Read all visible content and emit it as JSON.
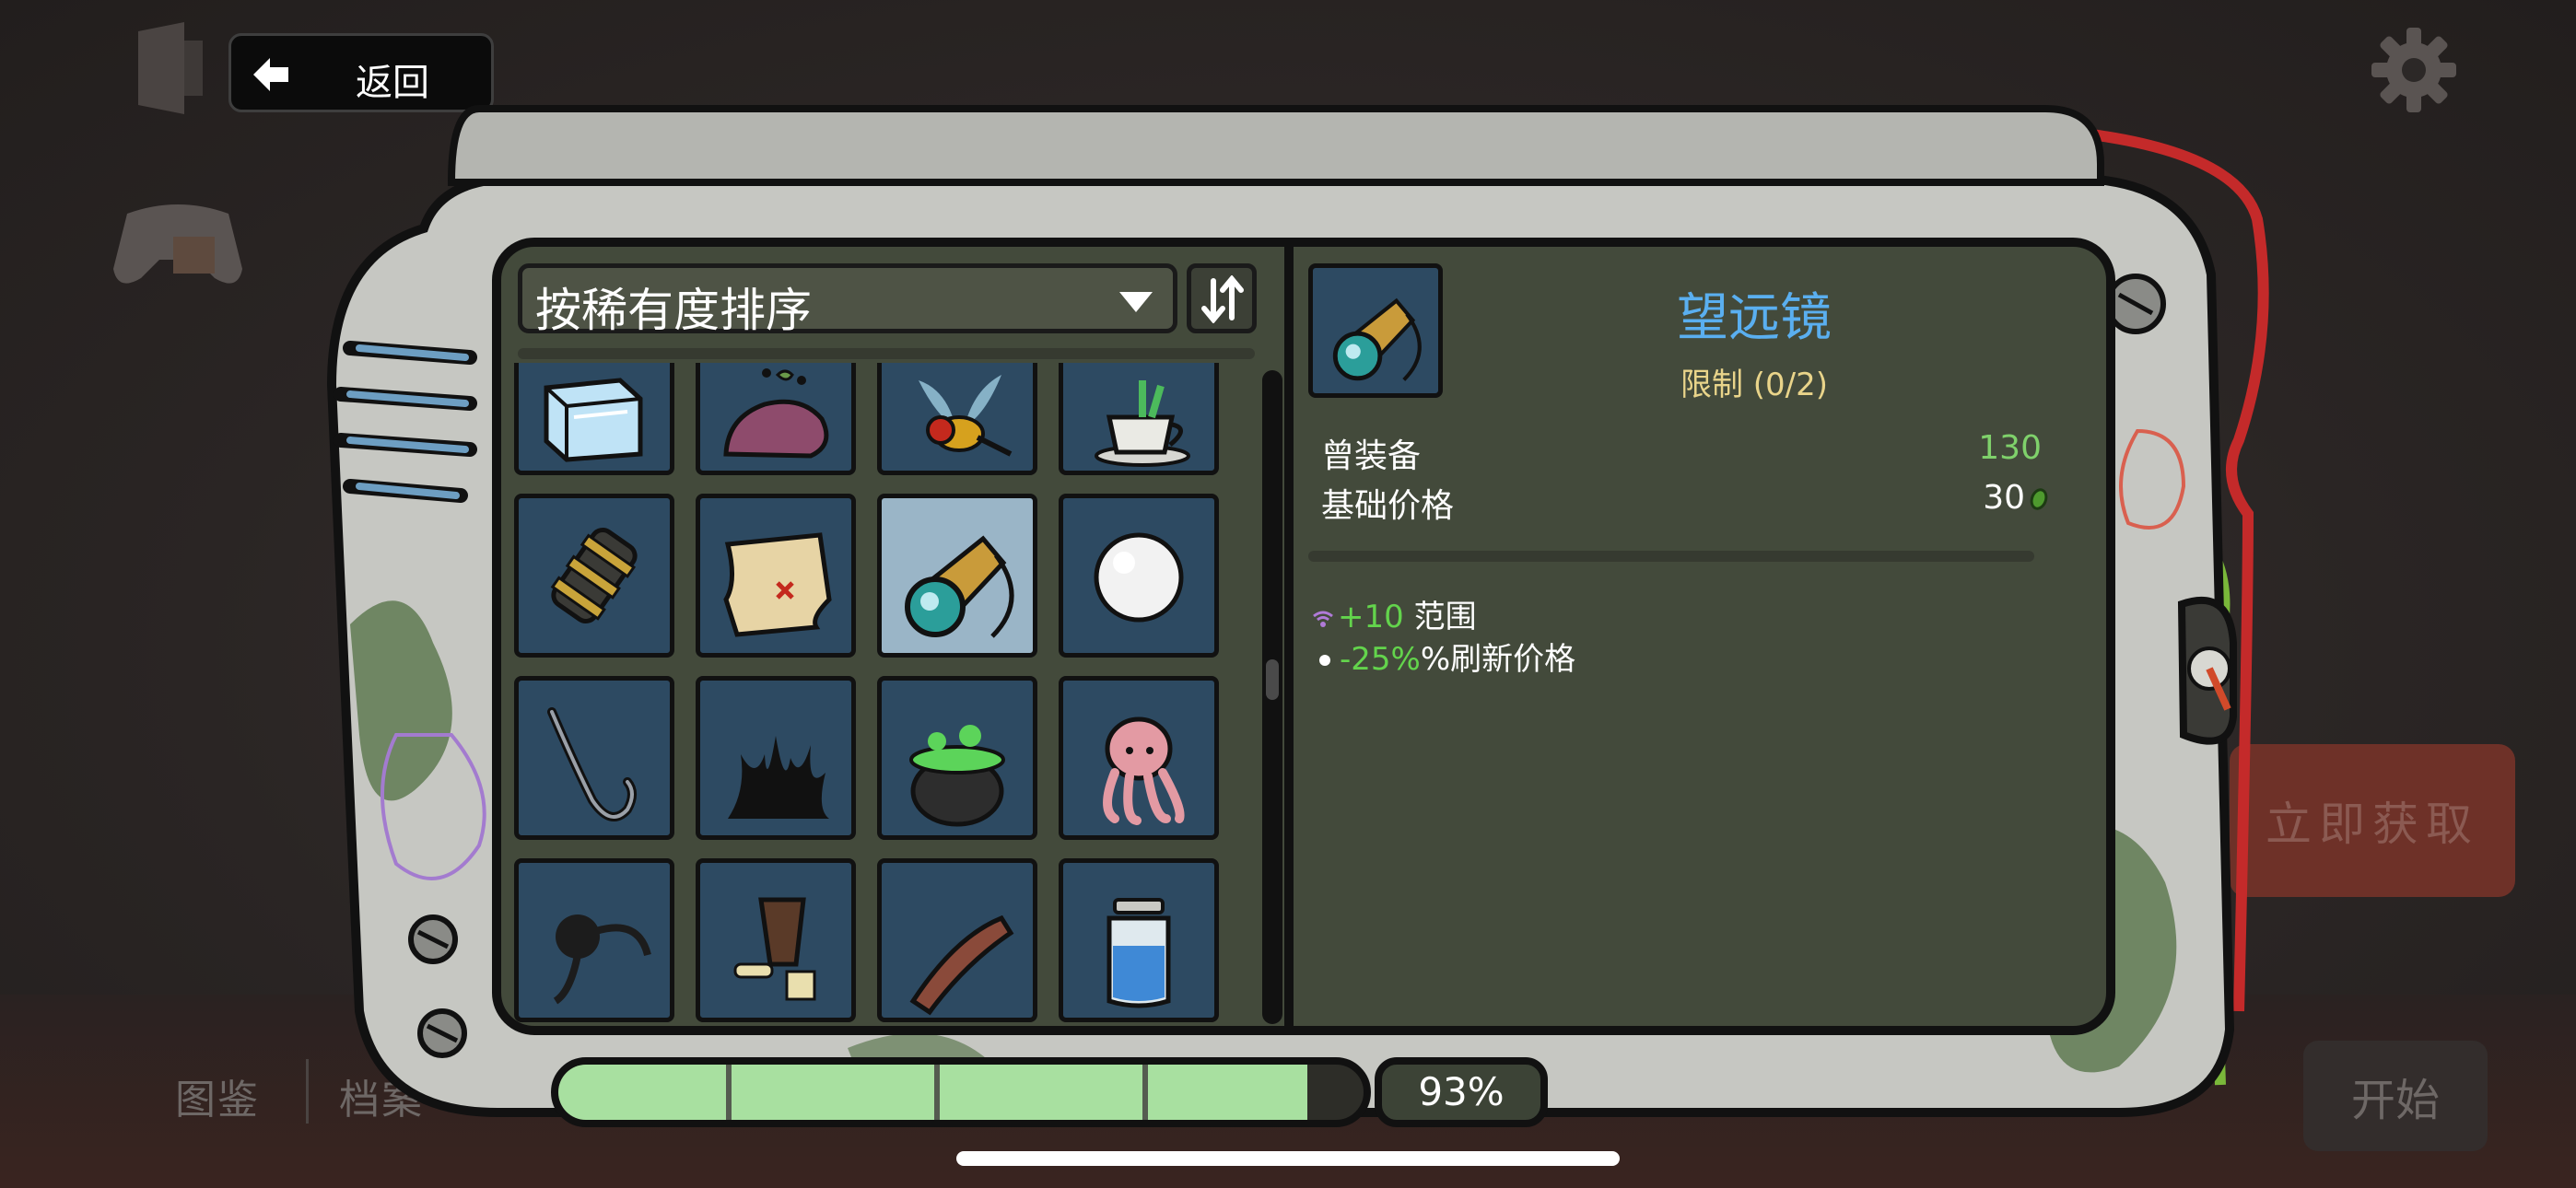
{
  "nav": {
    "back_label": "返回"
  },
  "background": {
    "bottom_menu": [
      "图鉴",
      "档案"
    ],
    "get_now_label": "立即获取",
    "start_label": "开始"
  },
  "tabs": [
    {
      "icon": "trophy-icon",
      "active": false
    },
    {
      "icon": "cube-icon",
      "active": true
    },
    {
      "icon": "sword-icon",
      "active": false
    },
    {
      "icon": "skull-icon",
      "active": false
    }
  ],
  "sort": {
    "label": "按稀有度排序",
    "order_icon": "sort-order-icon"
  },
  "items": [
    {
      "name": "ice-cube-icon"
    },
    {
      "name": "beast-remains-icon"
    },
    {
      "name": "wasp-icon"
    },
    {
      "name": "herbal-tea-icon"
    },
    {
      "name": "barrel-trap-icon"
    },
    {
      "name": "treasure-map-icon"
    },
    {
      "name": "telescope-icon",
      "selected": true
    },
    {
      "name": "pearl-icon"
    },
    {
      "name": "fishing-hook-icon"
    },
    {
      "name": "black-coral-icon"
    },
    {
      "name": "witch-cauldron-icon"
    },
    {
      "name": "octopus-icon"
    },
    {
      "name": "tentacle-icon"
    },
    {
      "name": "stump-bones-icon"
    },
    {
      "name": "meat-strip-icon"
    },
    {
      "name": "water-jar-icon"
    }
  ],
  "detail": {
    "title": "望远镜",
    "limit": "限制 (0/2)",
    "stats": [
      {
        "label": "曾装备",
        "value": "130",
        "color": "#7fd16b"
      },
      {
        "label": "基础价格",
        "value": "30",
        "color": "#ffffff",
        "currency_icon": "material-coin-icon"
      }
    ],
    "effects": [
      {
        "icon": "range-icon",
        "value": "+10",
        "text": " 范围"
      },
      {
        "icon": "bullet-dot",
        "value": "-25%",
        "text": "%刷新价格"
      }
    ]
  },
  "progress": {
    "percent_label": "93%",
    "fraction": 0.93,
    "segments": 4
  }
}
